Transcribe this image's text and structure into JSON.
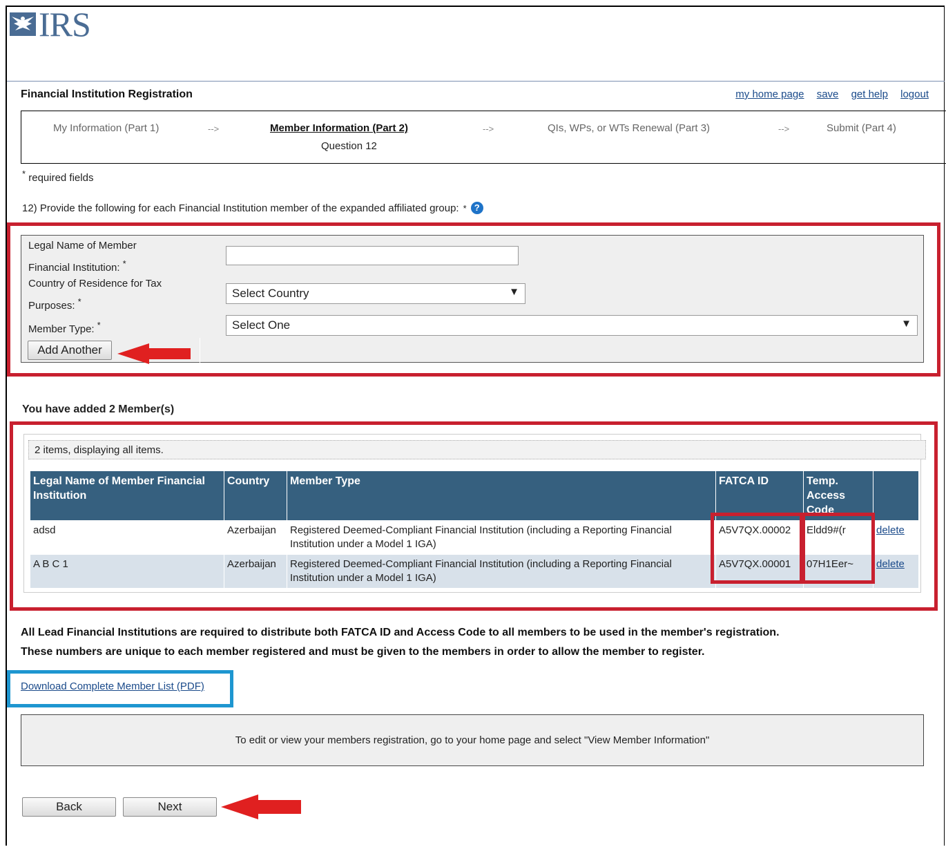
{
  "header": {
    "logo_text": "IRS",
    "title": "Financial Institution Registration",
    "links": [
      "my home page",
      "save",
      "get help",
      "logout"
    ]
  },
  "steps": {
    "items": [
      "My Information (Part 1)",
      "Member Information (Part 2)",
      "QIs, WPs, or WTs Renewal (Part 3)",
      "Submit (Part 4)"
    ],
    "separator": "-->",
    "active_sub": "Question 12"
  },
  "required_note": "required fields",
  "question": "12) Provide the following for each Financial Institution member of the expanded affiliated group:",
  "form": {
    "legal_name_label_1": "Legal Name of Member",
    "legal_name_label_2": "Financial Institution:",
    "legal_name_value": "",
    "country_label_1": "Country of Residence for Tax",
    "country_label_2": "Purposes:",
    "country_selected": "Select Country",
    "member_type_label": "Member Type:",
    "member_type_selected": "Select One",
    "add_button": "Add Another"
  },
  "members": {
    "heading": "You have added 2 Member(s)",
    "summary": "2 items, displaying all items.",
    "columns": [
      "Legal Name of Member Financial Institution",
      "Country",
      "Member Type",
      "FATCA ID",
      "Temp. Access Code",
      ""
    ],
    "rows": [
      {
        "name": "adsd",
        "country": "Azerbaijan",
        "type": "Registered Deemed-Compliant Financial Institution (including a Reporting Financial Institution under a Model 1 IGA)",
        "fatca_id": "A5V7QX.00002",
        "code": "Eldd9#(r",
        "action": "delete"
      },
      {
        "name": "A B C 1",
        "country": "Azerbaijan",
        "type": "Registered Deemed-Compliant Financial Institution (including a Reporting Financial Institution under a Model 1 IGA)",
        "fatca_id": "A5V7QX.00001",
        "code": "07H1Eer~",
        "action": "delete"
      }
    ]
  },
  "notice_1": "All Lead Financial Institutions are required to distribute both FATCA ID and Access Code to all members to be used in the member's registration.",
  "notice_2": "These numbers are unique to each member registered and must be given to the members in order to allow the member to register.",
  "download_link": "Download Complete Member List (PDF)",
  "info_text": "To edit or view your members registration, go to your home page and select \"View Member Information\"",
  "nav": {
    "back": "Back",
    "next": "Next"
  },
  "colors": {
    "annotation_red": "#c8202f",
    "annotation_blue": "#1e96d0",
    "table_header": "#36607f"
  }
}
